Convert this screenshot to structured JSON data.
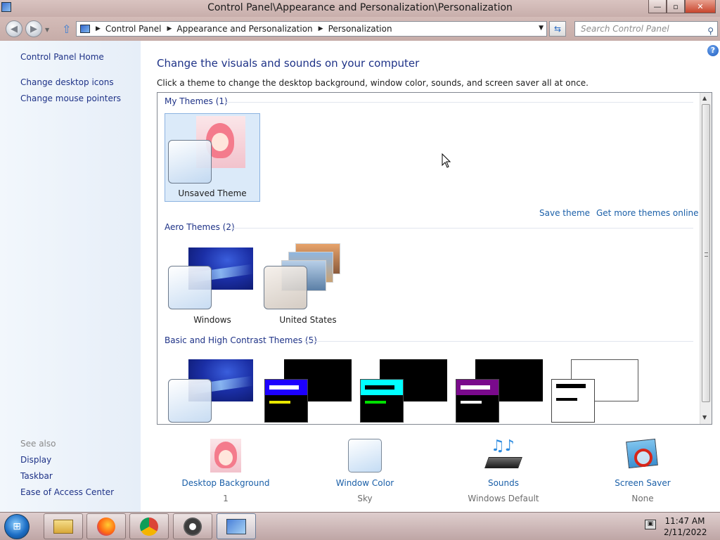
{
  "window": {
    "title": "Control Panel\\Appearance and Personalization\\Personalization",
    "minimize": "—",
    "maximize": "▫",
    "close": "✕"
  },
  "address": {
    "breadcrumbs": [
      "Control Panel",
      "Appearance and Personalization",
      "Personalization"
    ],
    "search_placeholder": "Search Control Panel"
  },
  "sidebar": {
    "home": "Control Panel Home",
    "links": [
      "Change desktop icons",
      "Change mouse pointers"
    ],
    "see_also_heading": "See also",
    "see_also": [
      "Display",
      "Taskbar",
      "Ease of Access Center"
    ]
  },
  "main": {
    "title": "Change the visuals and sounds on your computer",
    "description": "Click a theme to change the desktop background, window color, sounds, and screen saver all at once.",
    "help": "?"
  },
  "themes": {
    "my_themes_label": "My Themes (1)",
    "my_themes": [
      {
        "name": "Unsaved Theme",
        "selected": true
      }
    ],
    "save_theme": "Save theme",
    "get_more": "Get more themes online",
    "aero_label": "Aero Themes (2)",
    "aero": [
      {
        "name": "Windows"
      },
      {
        "name": "United States"
      }
    ],
    "basic_label": "Basic and High Contrast Themes (5)",
    "basic_count": 5
  },
  "customize": [
    {
      "label": "Desktop Background",
      "value": "1",
      "icon": "desktop-background-icon"
    },
    {
      "label": "Window Color",
      "value": "Sky",
      "icon": "window-color-icon"
    },
    {
      "label": "Sounds",
      "value": "Windows Default",
      "icon": "sounds-icon"
    },
    {
      "label": "Screen Saver",
      "value": "None",
      "icon": "screen-saver-icon"
    }
  ],
  "taskbar": {
    "apps": [
      "file-explorer-icon",
      "firefox-icon",
      "chrome-icon",
      "settings-icon",
      "control-panel-icon"
    ],
    "time": "11:47 AM",
    "date": "2/11/2022"
  },
  "colors": {
    "link": "#1e3287",
    "accent_link": "#1a5fa8",
    "selected_tile": "#dbeaf9"
  }
}
